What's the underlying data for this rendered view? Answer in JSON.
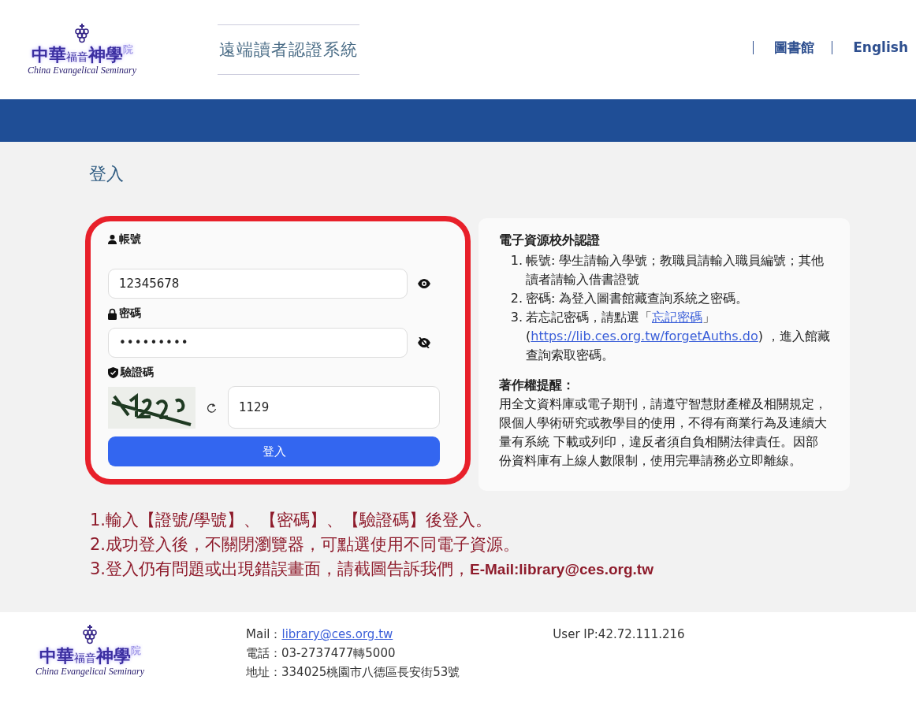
{
  "header": {
    "logo": {
      "parts": [
        {
          "text": "中華",
          "kind": "big"
        },
        {
          "text": "福音",
          "kind": "small"
        },
        {
          "text": "神學",
          "kind": "big"
        },
        {
          "text": "院",
          "kind": "raised"
        }
      ],
      "english": "China Evangelical Seminary"
    },
    "system_title": "遠端讀者認證系統",
    "nav": [
      "圖書館",
      "English"
    ]
  },
  "page_title": "登入",
  "login_form": {
    "account": {
      "label": "帳號",
      "value": "12345678"
    },
    "password": {
      "label": "密碼",
      "value": "•••••••••"
    },
    "captcha": {
      "label": "驗證碼",
      "value": "1129"
    },
    "submit": "登入"
  },
  "info": {
    "heading": "電子資源校外認證",
    "items": [
      {
        "marker": "1.",
        "text": "帳號: 學生請輸入學號；教職員請輸入職員編號；其他讀者請輸入借書證號"
      },
      {
        "marker": "2.",
        "text": "密碼: 為登入圖書館藏查詢系統之密碼。"
      },
      {
        "marker": "3.",
        "text": "若忘記密碼，請點選「",
        "link": "忘記密碼",
        "after": "」",
        "open": "(",
        "url": "https://lib.ces.org.tw/forgetAuths.do",
        "tail": ") ，進入館藏查詢索取密碼。"
      }
    ],
    "copyright_heading": "著作權提醒：",
    "copyright_text": "用全文資料庫或電子期刊，請遵守智慧財產權及相關規定，限個人學術研究或教學目的使用，不得有商業行為及連續大量有系統 下載或列印，違反者須自負相關法律責任。因部份資料庫有上線人數限制，使用完畢請務必立即離線。"
  },
  "instructions": [
    "1.輸入【證號/學號】、【密碼】、【驗證碼】後登入。",
    "2.成功登入後，不關閉瀏覽器，可點選使用不同電子資源。",
    "3.登入仍有問題或出現錯誤畫面，請截圖告訴我們，**E-Mail:library@ces.org.tw**"
  ],
  "footer": {
    "logo": {
      "parts": [
        {
          "text": "中華",
          "kind": "big"
        },
        {
          "text": "福音",
          "kind": "small"
        },
        {
          "text": "神學",
          "kind": "big"
        },
        {
          "text": "院",
          "kind": "raised"
        }
      ],
      "english": "China Evangelical Seminary"
    },
    "mail_label": "Mail：",
    "mail": "library@ces.org.tw",
    "phone": "電話：03-2737477轉5000",
    "address": "地址：334025桃園市八德區長安街53號",
    "user_ip": "User IP:42.72.111.216"
  }
}
